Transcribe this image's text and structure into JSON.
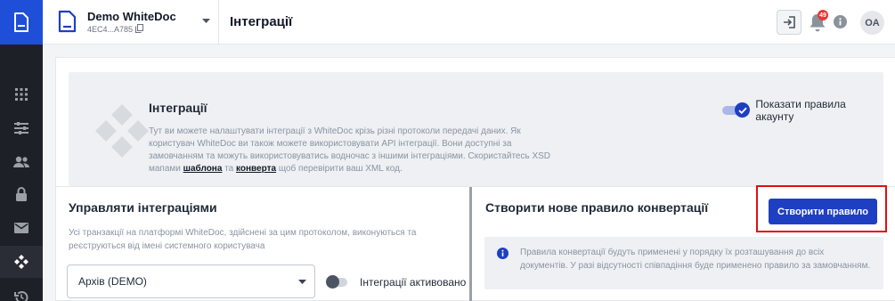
{
  "account": {
    "name": "Demo WhiteDoc",
    "id": "4EC4...A785"
  },
  "header": {
    "title": "Інтеграції",
    "notifications_count": "49",
    "avatar_initials": "OA"
  },
  "intro": {
    "title": "Інтеграції",
    "text_before": "Тут ви можете налаштувати інтеграції з WhiteDoc крізь різні протоколи передачі даних. Як користувач WhiteDoc ви також можете використовувати API інтеграції. Вони доступні за замовчанням та можуть використовуватись водночас з іншими інтеграціями. Скористайтесь XSD мапами ",
    "link_template": "шаблона",
    "text_and": " та ",
    "link_envelope": "конверта",
    "text_after": " щоб перевірити ваш XML код.",
    "show_rules_label": "Показати правила акаунту"
  },
  "manage": {
    "title": "Управляти інтеграціями",
    "description": "Усі транзакції на платформі WhiteDoc, здійснені за цим протоколом, виконуються та реєструються від імені системного користувача",
    "select_value": "Архів (DEMO)",
    "active_label": "Інтеграції активовано"
  },
  "convert": {
    "title": "Створити нове правило конвертації",
    "create_button": "Створити правило",
    "notice": "Правила конвертації будуть применені у порядку їх розташування до всіх документів. У разі відсутності співпадіння буде применено правило за замовчанням."
  },
  "colors": {
    "primary": "#1f3fc2",
    "rail": "#1e2027",
    "highlight": "#e01010",
    "badge": "#e53935"
  }
}
